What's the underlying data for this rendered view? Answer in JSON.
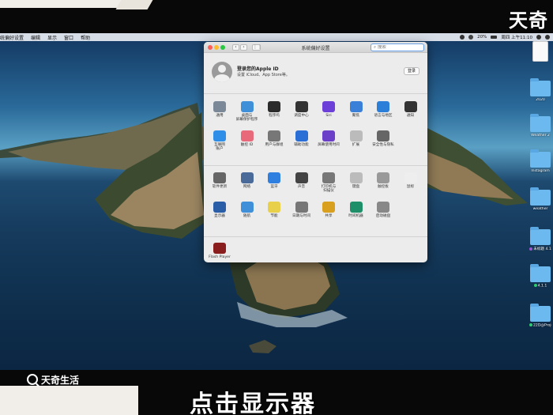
{
  "watermark": "天奇",
  "menubar": {
    "items": [
      "统偏好设置",
      "编辑",
      "显示",
      "窗口",
      "帮助"
    ],
    "battery": "20%",
    "datetime": "周四 上午11:10"
  },
  "window": {
    "title": "系统偏好设置",
    "search_placeholder": "搜索",
    "account": {
      "title": "登录您的Apple ID",
      "subtitle": "设置 iCloud、App Store等。",
      "login_label": "登录"
    },
    "section1": [
      {
        "label": "通用",
        "icon": "general-icon",
        "color": "#7a8898"
      },
      {
        "label": "桌面与\n屏幕保护程序",
        "icon": "desktop-screensaver-icon",
        "color": "#3f8fd9"
      },
      {
        "label": "程序坞",
        "icon": "dock-icon",
        "color": "#2b2b2b"
      },
      {
        "label": "调度中心",
        "icon": "mission-control-icon",
        "color": "#333"
      },
      {
        "label": "Siri",
        "icon": "siri-icon",
        "color": "#6b3fd8"
      },
      {
        "label": "聚焦",
        "icon": "spotlight-icon",
        "color": "#3a7fd8"
      },
      {
        "label": "语言与地区",
        "icon": "language-region-icon",
        "color": "#2c7fd8"
      },
      {
        "label": "通知",
        "icon": "notifications-icon",
        "color": "#333"
      },
      {
        "label": "互联网\n账户",
        "icon": "internet-accounts-icon",
        "color": "#2f8fe8"
      },
      {
        "label": "触控 ID",
        "icon": "touch-id-icon",
        "color": "#e86a7a"
      },
      {
        "label": "用户与群组",
        "icon": "users-groups-icon",
        "color": "#777"
      },
      {
        "label": "辅助功能",
        "icon": "accessibility-icon",
        "color": "#2a6fd6"
      },
      {
        "label": "屏幕使用时间",
        "icon": "screen-time-icon",
        "color": "#6b3fc8"
      },
      {
        "label": "扩展",
        "icon": "extensions-icon",
        "color": "#bbb"
      },
      {
        "label": "安全性与隐私",
        "icon": "security-privacy-icon",
        "color": "#666"
      }
    ],
    "section2": [
      {
        "label": "软件更新",
        "icon": "software-update-icon",
        "color": "#666"
      },
      {
        "label": "网络",
        "icon": "network-icon",
        "color": "#4a6a9a"
      },
      {
        "label": "蓝牙",
        "icon": "bluetooth-icon",
        "color": "#2f7fe0"
      },
      {
        "label": "声音",
        "icon": "sound-icon",
        "color": "#444"
      },
      {
        "label": "打印机与\n扫描仪",
        "icon": "printers-scanners-icon",
        "color": "#777"
      },
      {
        "label": "键盘",
        "icon": "keyboard-icon",
        "color": "#bbb"
      },
      {
        "label": "触控板",
        "icon": "trackpad-icon",
        "color": "#999"
      },
      {
        "label": "鼠标",
        "icon": "mouse-icon",
        "color": "#eee"
      },
      {
        "label": "显示器",
        "icon": "displays-icon",
        "color": "#2a5fa8"
      },
      {
        "label": "随航",
        "icon": "sidecar-icon",
        "color": "#3f8fd9"
      },
      {
        "label": "节能",
        "icon": "energy-saver-icon",
        "color": "#e9d04a"
      },
      {
        "label": "日期与时间",
        "icon": "date-time-icon",
        "color": "#777"
      },
      {
        "label": "共享",
        "icon": "sharing-icon",
        "color": "#d9a020"
      },
      {
        "label": "时间机器",
        "icon": "time-machine-icon",
        "color": "#1f8f6a"
      },
      {
        "label": "启动磁盘",
        "icon": "startup-disk-icon",
        "color": "#888"
      }
    ],
    "section3": [
      {
        "label": "Flash Player",
        "icon": "flash-player-icon",
        "color": "#8a1d1d"
      }
    ]
  },
  "desktop": [
    {
      "label": "",
      "icon": "document-icon",
      "kind": "doc"
    },
    {
      "label": "2020",
      "icon": "folder-icon",
      "kind": "folder"
    },
    {
      "label": "Weather 2",
      "icon": "folder-icon",
      "kind": "folder"
    },
    {
      "label": "Instagram",
      "icon": "folder-icon",
      "kind": "folder"
    },
    {
      "label": "weather",
      "icon": "folder-icon",
      "kind": "folder"
    },
    {
      "label": "未标题 4.1",
      "icon": "folder-icon",
      "kind": "folder",
      "tag": "#9b59d0"
    },
    {
      "label": "4.1.1",
      "icon": "folder-icon",
      "kind": "folder",
      "tag": "#2ecc71"
    },
    {
      "label": "22D@Projec",
      "icon": "folder-icon",
      "kind": "folder",
      "tag": "#2ecc71"
    }
  ],
  "bottom_logo": "天奇生活",
  "caption": "点击显示器"
}
